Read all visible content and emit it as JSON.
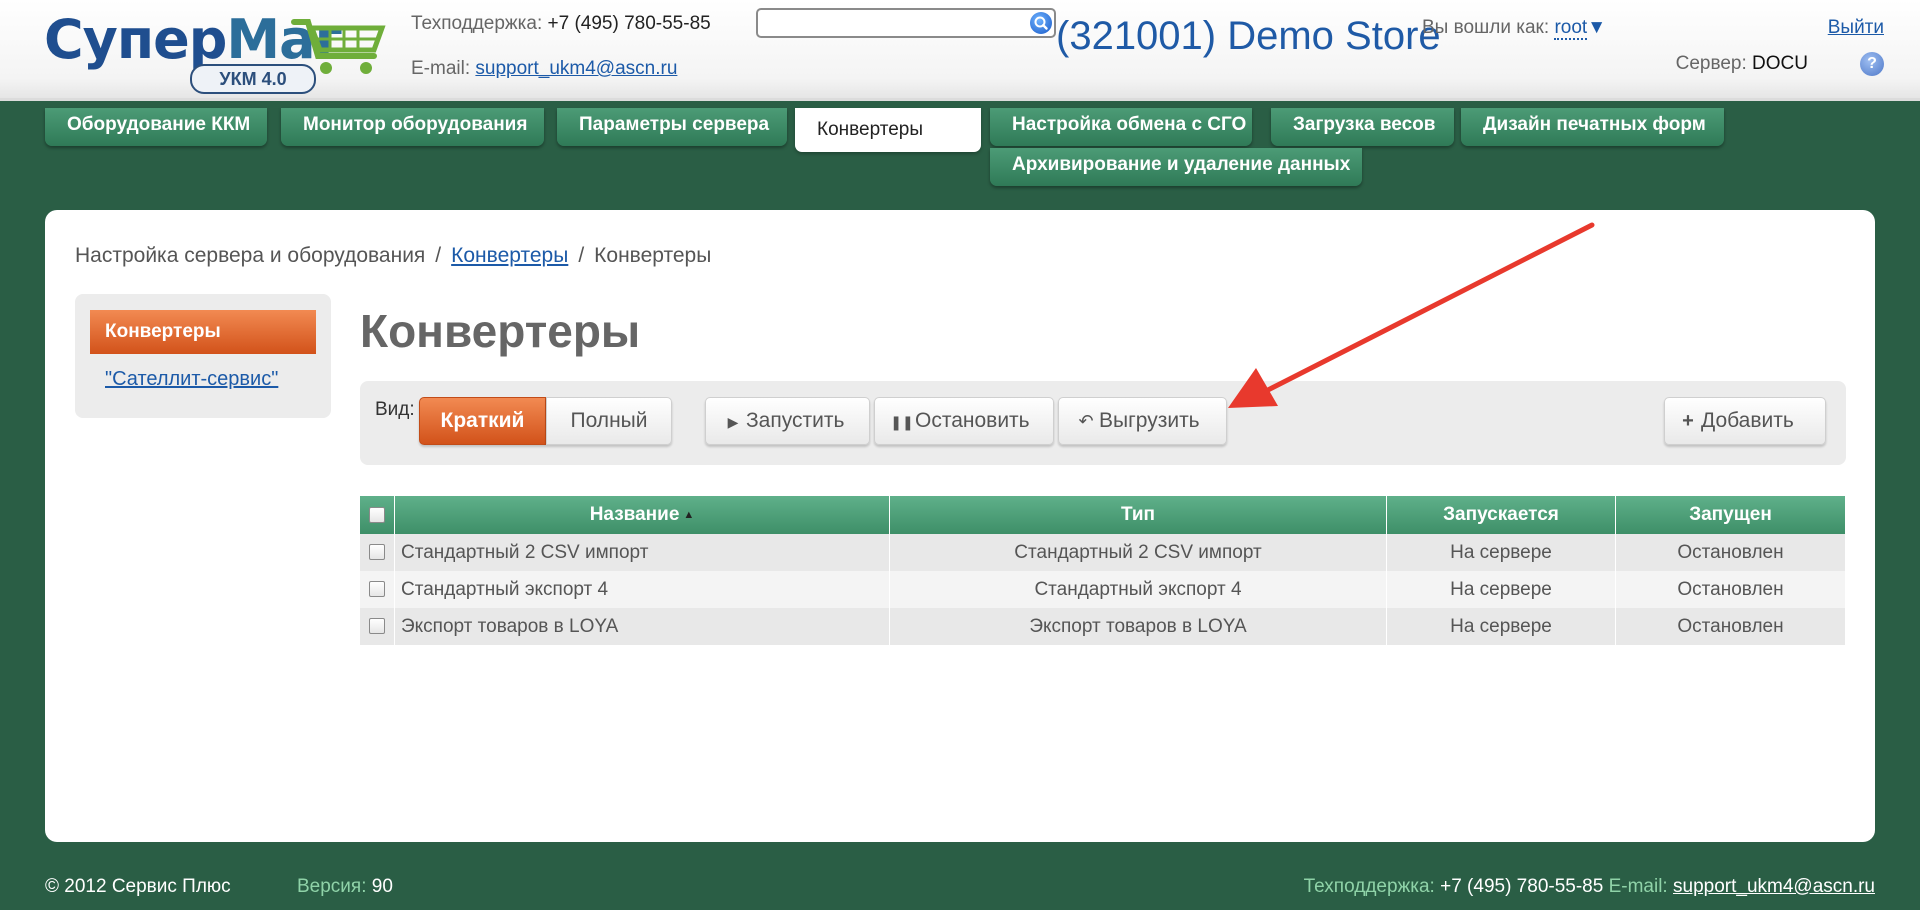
{
  "header": {
    "logo": {
      "word_a": "Супер",
      "word_b": "Маг",
      "badge": "УКМ 4.0"
    },
    "support_label": "Техподдержка:",
    "support_phone": "+7 (495) 780-55-85",
    "email_label": "E-mail:",
    "email": "support_ukm4@ascn.ru",
    "search_placeholder": "",
    "store_title": "(321001) Demo Store",
    "logged_in_label": "Вы вошли как:",
    "user": "root",
    "user_caret": "▼",
    "logout": "Выйти",
    "server_label": "Сервер:",
    "server": "DOCU",
    "help": "?"
  },
  "nav": {
    "tabs": [
      {
        "label": "Оборудование ККМ"
      },
      {
        "label": "Монитор оборудования"
      },
      {
        "label": "Параметры сервера"
      },
      {
        "label": "Конвертеры"
      },
      {
        "label": "Настройка обмена с СГО"
      },
      {
        "label": "Загрузка весов"
      },
      {
        "label": "Дизайн печатных форм"
      },
      {
        "label": "Архивирование и удаление данных"
      }
    ],
    "active_index": 3
  },
  "breadcrumb": {
    "items": [
      "Настройка сервера и оборудования",
      "Конвертеры",
      "Конвертеры"
    ],
    "separator": "/"
  },
  "sidebar": {
    "active_item": "Конвертеры",
    "link": "\"Сателлит-сервис\""
  },
  "page_title": "Конвертеры",
  "toolbar": {
    "view_label": "Вид:",
    "view_short": "Краткий",
    "view_full": "Полный",
    "start": "Запустить",
    "stop": "Остановить",
    "export": "Выгрузить",
    "add": "Добавить",
    "icons": {
      "start": "play-icon",
      "stop": "pause-icon",
      "export": "undo-icon",
      "add": "plus-icon"
    }
  },
  "table": {
    "columns": [
      "Название",
      "Тип",
      "Запускается",
      "Запущен"
    ],
    "sort": {
      "column": "Название",
      "direction": "asc"
    },
    "rows": [
      {
        "name": "Стандартный 2 CSV импорт",
        "type": "Стандартный 2 CSV импорт",
        "runs": "На сервере",
        "status": "Остановлен"
      },
      {
        "name": "Стандартный экспорт 4",
        "type": "Стандартный экспорт 4",
        "runs": "На сервере",
        "status": "Остановлен"
      },
      {
        "name": "Экспорт товаров в LOYA",
        "type": "Экспорт товаров в LOYA",
        "runs": "На сервере",
        "status": "Остановлен"
      }
    ]
  },
  "footer": {
    "copyright": "© 2012 Сервис Плюс",
    "version_label": "Версия:",
    "version": "90",
    "support_label": "Техподдержка:",
    "support_phone": "+7 (495) 780-55-85",
    "email_label": "E-mail:",
    "email": "support_ukm4@ascn.ru"
  },
  "colors": {
    "brand_green": "#2a5e45",
    "tab_green": "#3e8f68",
    "accent_orange": "#d2521a",
    "link_blue": "#1c5aa8",
    "annotation_arrow": "#e8392d"
  }
}
